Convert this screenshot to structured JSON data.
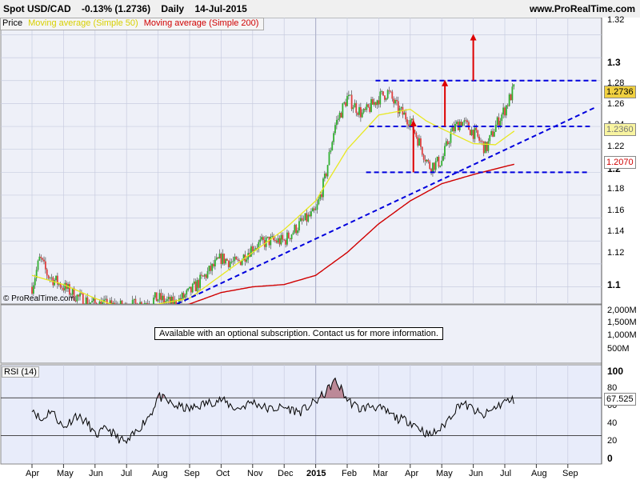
{
  "header": {
    "symbol": "Spot USD/CAD",
    "change": "-0.13% (1.2736)",
    "period": "Daily",
    "date": "14-Jul-2015",
    "site": "www.ProRealTime.com"
  },
  "legend": {
    "price": "Price",
    "ma50": "Moving average (Simple 50)",
    "ma200": "Moving average (Simple 200)"
  },
  "watermark": "© ProRealTime.com",
  "volume_panel": {
    "notice": "Available with an optional subscription. Contact us for more information.",
    "axis_labels": [
      "2,000M",
      "1,500M",
      "1,000M",
      "500M"
    ]
  },
  "rsi_panel": {
    "label": "RSI (14)",
    "axis_labels": [
      "100",
      "80",
      "60",
      "40",
      "20",
      "0"
    ],
    "current_badge": "67.525"
  },
  "price_axis": {
    "labels": [
      "1.32",
      "1.3",
      "1.28",
      "1.26",
      "1.24",
      "1.22",
      "1.2",
      "1.18",
      "1.16",
      "1.14",
      "1.12",
      "1.1"
    ],
    "badges": {
      "last": "1.2736",
      "ma50": "1.2360",
      "ma200": "1.2070"
    }
  },
  "time_axis": {
    "labels": [
      "Apr",
      "May",
      "Jun",
      "Jul",
      "Aug",
      "Sep",
      "Oct",
      "Nov",
      "Dec",
      "2015",
      "Feb",
      "Mar",
      "Apr",
      "May",
      "Jun",
      "Jul",
      "Aug",
      "Sep"
    ]
  },
  "colors": {
    "ma50": "#e8e820",
    "ma200": "#d00000",
    "up": "#30b030",
    "down": "#e04040",
    "guides": "#0000dd",
    "arrows": "#dd0000",
    "panel_bg": "#e8ecfa"
  },
  "chart_data": {
    "type": "candlestick",
    "title": "Spot USD/CAD",
    "ylim": [
      1.085,
      1.335
    ],
    "last_close": 1.2736,
    "ma50_last": 1.236,
    "ma200_last": 1.207,
    "months": [
      "Apr",
      "May",
      "Jun",
      "Jul",
      "Aug",
      "Sep",
      "Oct",
      "Nov",
      "Dec",
      "2015",
      "Feb",
      "Mar",
      "Apr",
      "May",
      "Jun",
      "Jul",
      "Aug",
      "Sep"
    ],
    "close_anchors": [
      [
        0,
        1.1
      ],
      [
        0.25,
        1.125
      ],
      [
        0.5,
        1.11
      ],
      [
        1,
        1.1
      ],
      [
        1.5,
        1.09
      ],
      [
        2,
        1.085
      ],
      [
        3,
        1.082
      ],
      [
        4,
        1.09
      ],
      [
        4.5,
        1.085
      ],
      [
        5,
        1.095
      ],
      [
        5.5,
        1.11
      ],
      [
        6,
        1.125
      ],
      [
        6.5,
        1.12
      ],
      [
        7,
        1.135
      ],
      [
        7.5,
        1.14
      ],
      [
        8,
        1.14
      ],
      [
        8.5,
        1.155
      ],
      [
        9,
        1.165
      ],
      [
        9.3,
        1.195
      ],
      [
        9.6,
        1.24
      ],
      [
        10,
        1.265
      ],
      [
        10.5,
        1.25
      ],
      [
        11,
        1.265
      ],
      [
        11.3,
        1.27
      ],
      [
        11.6,
        1.255
      ],
      [
        12,
        1.245
      ],
      [
        12.3,
        1.225
      ],
      [
        12.6,
        1.205
      ],
      [
        13,
        1.21
      ],
      [
        13.3,
        1.235
      ],
      [
        13.6,
        1.245
      ],
      [
        14,
        1.235
      ],
      [
        14.4,
        1.22
      ],
      [
        14.7,
        1.24
      ],
      [
        15,
        1.255
      ],
      [
        15.3,
        1.2736
      ]
    ],
    "ma50_anchors": [
      [
        0,
        1.11
      ],
      [
        1,
        1.102
      ],
      [
        2,
        1.09
      ],
      [
        3,
        1.08
      ],
      [
        4,
        1.085
      ],
      [
        5,
        1.09
      ],
      [
        6,
        1.11
      ],
      [
        7,
        1.13
      ],
      [
        8,
        1.15
      ],
      [
        9,
        1.175
      ],
      [
        10,
        1.22
      ],
      [
        11,
        1.25
      ],
      [
        12,
        1.255
      ],
      [
        12.5,
        1.245
      ],
      [
        13,
        1.238
      ],
      [
        14,
        1.225
      ],
      [
        14.7,
        1.224
      ],
      [
        15.3,
        1.236
      ]
    ],
    "ma200_anchors": [
      [
        4.6,
        1.083
      ],
      [
        5,
        1.085
      ],
      [
        6,
        1.095
      ],
      [
        7,
        1.1
      ],
      [
        8,
        1.102
      ],
      [
        9,
        1.11
      ],
      [
        10,
        1.13
      ],
      [
        11,
        1.155
      ],
      [
        12,
        1.175
      ],
      [
        13,
        1.19
      ],
      [
        14,
        1.198
      ],
      [
        15,
        1.205
      ],
      [
        15.3,
        1.207
      ]
    ],
    "rsi_anchors": [
      [
        0,
        60
      ],
      [
        0.3,
        45
      ],
      [
        0.6,
        58
      ],
      [
        1,
        38
      ],
      [
        1.4,
        52
      ],
      [
        1.8,
        42
      ],
      [
        2,
        30
      ],
      [
        2.4,
        38
      ],
      [
        2.7,
        28
      ],
      [
        3,
        22
      ],
      [
        3.4,
        38
      ],
      [
        3.8,
        55
      ],
      [
        4,
        72
      ],
      [
        4.5,
        62
      ],
      [
        5,
        58
      ],
      [
        5.5,
        64
      ],
      [
        6,
        68
      ],
      [
        6.5,
        58
      ],
      [
        7,
        66
      ],
      [
        7.5,
        58
      ],
      [
        8,
        60
      ],
      [
        8.5,
        55
      ],
      [
        9,
        66
      ],
      [
        9.3,
        75
      ],
      [
        9.6,
        88
      ],
      [
        9.8,
        80
      ],
      [
        10,
        68
      ],
      [
        10.4,
        58
      ],
      [
        10.8,
        62
      ],
      [
        11.2,
        56
      ],
      [
        11.6,
        48
      ],
      [
        12,
        45
      ],
      [
        12.3,
        38
      ],
      [
        12.6,
        30
      ],
      [
        13,
        38
      ],
      [
        13.3,
        52
      ],
      [
        13.6,
        65
      ],
      [
        14,
        58
      ],
      [
        14.3,
        50
      ],
      [
        14.7,
        60
      ],
      [
        15,
        66
      ],
      [
        15.3,
        67.525
      ]
    ],
    "rsi_overbought": 70,
    "rsi_oversold": 30,
    "support_levels": [
      1.28,
      1.24,
      1.2
    ],
    "trendline": [
      [
        4.6,
        1.085
      ],
      [
        17.9,
        1.257
      ]
    ],
    "up_arrows": [
      [
        12.1,
        1.2,
        1.245
      ],
      [
        13.1,
        1.24,
        1.28
      ],
      [
        14.0,
        1.28,
        1.32
      ]
    ]
  }
}
